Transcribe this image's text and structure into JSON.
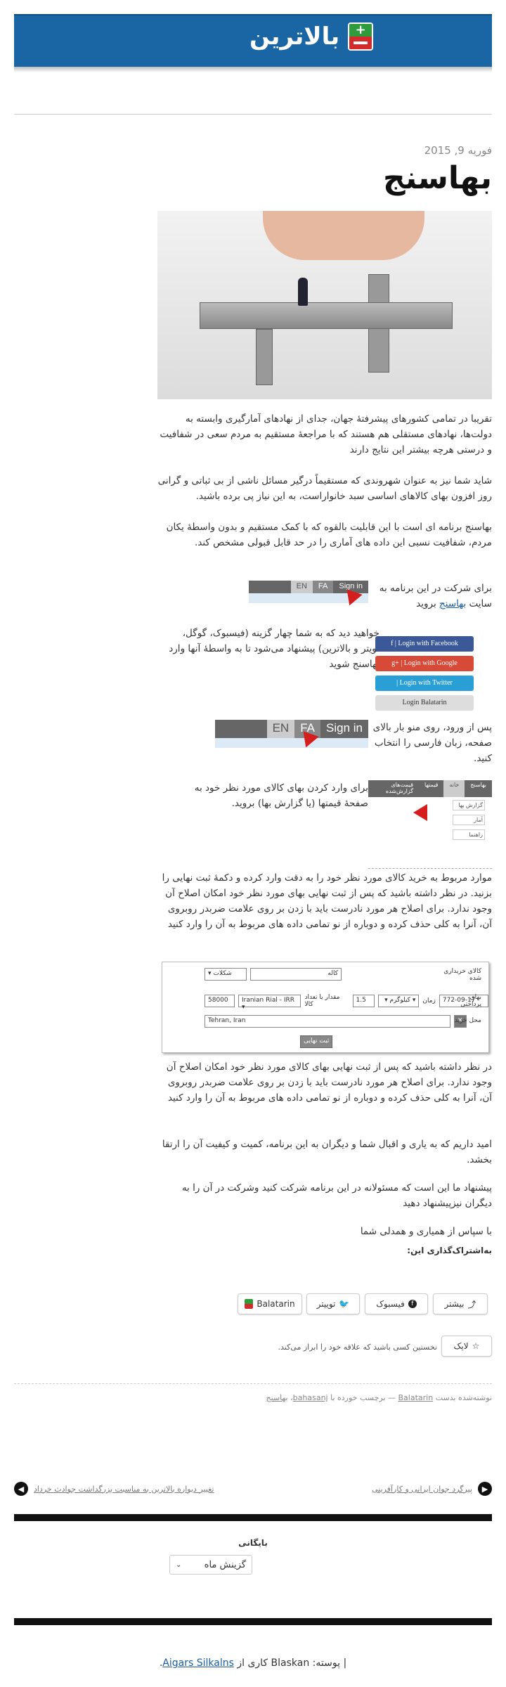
{
  "site": {
    "logo_text": "بالاترین",
    "logo_plus": "+"
  },
  "post": {
    "date": "فوریه 9, 2015",
    "title": "بهاسنج",
    "p1": "تقریبا در تمامی کشورهای پیشرفتهٔ جهان، جدای از نهادهای آمارگیری وابسته به دولت‌ها، نهادهای مستقلی هم هستند که با مراجعهٔ مستقیم به مردم سعی در شفافیت و درستی هرچه بیشتر این نتایج دارند",
    "p2": "شاید شما نیز به عنوان شهروندی که مستقیماً درگیر مسائل ناشی از بی ثباتی و گرانی روز افزون بهای کالاهای اساسی سبد خانواراست، به این نیاز پی برده باشید.",
    "p3": "بهاسنج برنامه ای است با این قابلیت بالقوه که با کمک مستقیم و بدون واسطهٔ یکان مردم، شفافیت نسبی این داده های آماری را در حد قابل قبولی مشخص کند.",
    "p4_pre": "برای شرکت در این برنامه به سایت",
    "p4_link": "بهاسنج",
    "p4_post": "بروید",
    "p5": "خواهید دید که به شما چهار گزینه (فیسبوک، گوگل، تویتر و بالاترین) پیشنهاد می‌شود تا به واسطهٔ آنها وارد بهاسنج شوید",
    "p6": "پس از ورود، روی منو بار بالای صفحه، زبان فارسی را انتخاب کنید.",
    "p7": "برای وارد کردن بهای کالای مورد نظر خود به صفحهٔ قیمتها (یا گزارش بها) بروید.",
    "p8": "موارد مربوط به خرید کالای مورد نظر خود را به دقت وارد کرده و دکمهٔ ثبت نهایی را بزنید. در نظر داشته باشید که پس از ثبت نهایی بهای مورد نظر خود امکان اصلاح آن وجود ندارد. برای اصلاح هر مورد نادرست باید با زدن بر روی علامت ضربدر روبروی آن، آنرا به کلی حذف کرده و دوباره از نو تمامی داده های مربوط به آن را وارد کنید",
    "p9": "در نظر داشته باشید که پس از ثبت نهایی بهای کالای مورد نظر خود امکان اصلاح آن وجود ندارد. برای اصلاح هر مورد نادرست باید با زدن بر روی علامت ضربدر روبروی آن، آنرا به کلی حذف کرده و دوباره از نو تمامی داده های مربوط به آن را وارد کنید",
    "p10": "امید داریم که به یاری و اقبال شما و دیگران به این برنامه، کمیت و کیفیت آن را ارتقا بخشد.",
    "p11": "پیشنهاد ما این است که مسئولانه در این برنامه شرکت کنید وشرکت در آن را به دیگران نیزپیشنهاد دهید",
    "p12": "با سپاس از همیاری و همدلی شما"
  },
  "screens": {
    "sign_in": "Sign in",
    "fa": "FA",
    "en": "EN",
    "fb": "f | Login with Facebook",
    "google": "g+ | Login with Google",
    "twitter": "| Login with Twitter",
    "balatarin": "Login Balatarin",
    "menu1": "قیمت‌های گزارش‌شده",
    "menu2": "قیمتها",
    "menu3": "خانه",
    "menu4": "بهاسنج",
    "sub1": "گزارش بها",
    "sub2": "آمار",
    "sub3": "راهنما",
    "f_label1": "کالای خریداری شده",
    "f_select1": "▾ شکلات",
    "f_input1": "کاله",
    "f_label2": "بهای پرداختی",
    "f_price": "58000",
    "f_currency": "Iranian Rial - IRR ▾",
    "f_qty_label": "مقدار یا تعداد کالا",
    "f_qty": "1.5",
    "f_unit": "▾ کیلوگرم ▾",
    "f_date_label": "زمان",
    "f_date": "772-09-17",
    "f_label3": "محل خرید",
    "f_place": "Tehran, Iran",
    "f_submit": "ثبت نهایی",
    "f_x": "✕"
  },
  "share": {
    "heading": "به‌اشتراک‌گذاری این:",
    "more": "بیشتر",
    "facebook": "فیسبوک",
    "twitter": "توییتر",
    "balatarin": "Balatarin",
    "like": "لایک",
    "like_note": "نخستین کسی باشید که علاقه خود را ابراز می‌کند."
  },
  "meta": {
    "prefix": "نوشته‌شده بدست",
    "author": "Balatarin",
    "mid": "— برچسب خورده با",
    "tag1": "bahasanj",
    "tag2": "بهاسنج"
  },
  "nav": {
    "prev": "پیرگرد جوان ایرانی و کارآفرینی",
    "next": "تغییر دیواره بالاترین به مناسبت بزرگداشت جوادث خرداد"
  },
  "archive": {
    "heading": "بایگانی",
    "select": "گزینش ماه"
  },
  "footer": {
    "pre": "| پوسته: Blaskan کاری از",
    "author": "Aigars Silkalns",
    "post": "."
  }
}
